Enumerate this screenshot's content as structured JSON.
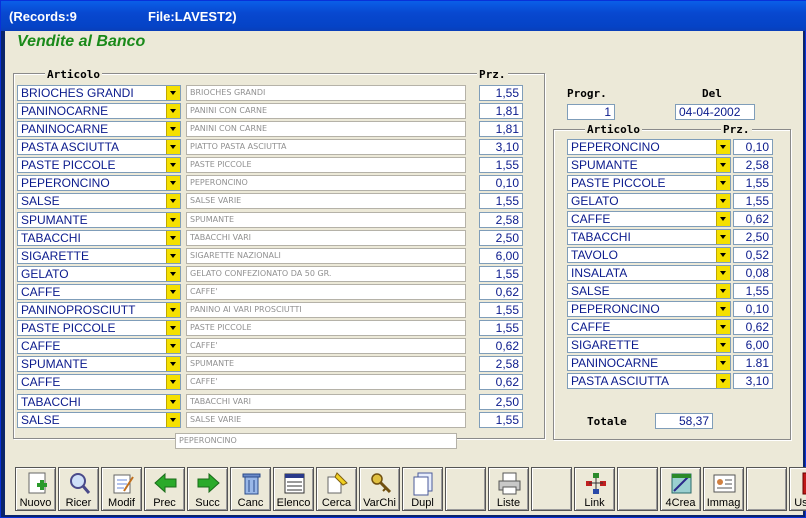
{
  "window": {
    "records": "(Records:9",
    "file": "File:LAVEST2)"
  },
  "app_title": "Vendite al Banco",
  "left": {
    "group_label": "Articolo",
    "price_label": "Prz.",
    "rows": [
      {
        "item": "BRIOCHES GRANDI",
        "desc": "BRIOCHES GRANDI",
        "price": "1,55"
      },
      {
        "item": "PANINOCARNE",
        "desc": "PANINI CON CARNE",
        "price": "1,81"
      },
      {
        "item": "PANINOCARNE",
        "desc": "PANINI CON CARNE",
        "price": "1,81"
      },
      {
        "item": "PASTA ASCIUTTA",
        "desc": "PIATTO PASTA ASCIUTTA",
        "price": "3,10"
      },
      {
        "item": "PASTE PICCOLE",
        "desc": "PASTE PICCOLE",
        "price": "1,55"
      },
      {
        "item": "PEPERONCINO",
        "desc": "PEPERONCINO",
        "price": "0,10"
      },
      {
        "item": "SALSE",
        "desc": "SALSE VARIE",
        "price": "1,55"
      },
      {
        "item": "SPUMANTE",
        "desc": "SPUMANTE",
        "price": "2,58"
      },
      {
        "item": "TABACCHI",
        "desc": "TABACCHI VARI",
        "price": "2,50"
      },
      {
        "item": "SIGARETTE",
        "desc": "SIGARETTE NAZIONALI",
        "price": "6,00"
      },
      {
        "item": "GELATO",
        "desc": "GELATO CONFEZIONATO DA 50 GR.",
        "price": "1,55"
      },
      {
        "item": "CAFFE",
        "desc": "CAFFE'",
        "price": "0,62"
      },
      {
        "item": "PANINOPROSCIUTT",
        "desc": "PANINO AI VARI PROSCIUTTI",
        "price": "1,55"
      },
      {
        "item": "PASTE PICCOLE",
        "desc": "PASTE PICCOLE",
        "price": "1,55"
      },
      {
        "item": "CAFFE",
        "desc": "CAFFE'",
        "price": "0,62"
      },
      {
        "item": "SPUMANTE",
        "desc": "SPUMANTE",
        "price": "2,58"
      },
      {
        "item": "CAFFE",
        "desc": "CAFFE'",
        "price": "0,62"
      },
      {
        "item": "TABACCHI",
        "desc": "TABACCHI VARI",
        "price": "2,50"
      },
      {
        "item": "SALSE",
        "desc": "SALSE VARIE",
        "price": "1,55"
      }
    ],
    "footer_desc": "PEPERONCINO"
  },
  "right": {
    "progr_label": "Progr.",
    "progr_value": "1",
    "del_label": "Del",
    "del_value": "04-04-2002",
    "group_label": "Articolo",
    "price_label": "Prz.",
    "rows": [
      {
        "item": "PEPERONCINO",
        "price": "0,10"
      },
      {
        "item": "SPUMANTE",
        "price": "2,58"
      },
      {
        "item": "PASTE PICCOLE",
        "price": "1,55"
      },
      {
        "item": "GELATO",
        "price": "1,55"
      },
      {
        "item": "CAFFE",
        "price": "0,62"
      },
      {
        "item": "TABACCHI",
        "price": "2,50"
      },
      {
        "item": "TAVOLO",
        "price": "0,52"
      },
      {
        "item": "INSALATA",
        "price": "0,08"
      },
      {
        "item": "SALSE",
        "price": "1,55"
      },
      {
        "item": "PEPERONCINO",
        "price": "0,10"
      },
      {
        "item": "CAFFE",
        "price": "0,62"
      },
      {
        "item": "SIGARETTE",
        "price": "6,00"
      },
      {
        "item": "PANINOCARNE",
        "price": "1.81"
      },
      {
        "item": "PASTA ASCIUTTA",
        "price": "3,10"
      }
    ],
    "total_label": "Totale",
    "total_value": "58,37"
  },
  "toolbar": [
    {
      "label": "Nuovo",
      "icon": "new-document-icon"
    },
    {
      "label": "Ricer",
      "icon": "search-icon"
    },
    {
      "label": "Modif",
      "icon": "edit-icon"
    },
    {
      "label": "Prec",
      "icon": "arrow-left-icon"
    },
    {
      "label": "Succ",
      "icon": "arrow-right-icon"
    },
    {
      "label": "Canc",
      "icon": "trash-icon"
    },
    {
      "label": "Elenco",
      "icon": "list-icon"
    },
    {
      "label": "Cerca",
      "icon": "find-icon"
    },
    {
      "label": "VarChi",
      "icon": "keys-icon"
    },
    {
      "label": "Dupl",
      "icon": "duplicate-icon"
    },
    {
      "label": "",
      "icon": ""
    },
    {
      "label": "Liste",
      "icon": "printer-icon"
    },
    {
      "label": "",
      "icon": ""
    },
    {
      "label": "Link",
      "icon": "link-tree-icon"
    },
    {
      "label": "",
      "icon": ""
    },
    {
      "label": "4Crea",
      "icon": "create-icon"
    },
    {
      "label": "Immag",
      "icon": "image-card-icon"
    },
    {
      "label": "",
      "icon": ""
    },
    {
      "label": "Uscita",
      "icon": "exit-door-icon"
    }
  ],
  "colors": {
    "accent_text": "#0a1a8c",
    "title_green": "#1a8a1a",
    "dropdown_yellow": "#f5e000"
  }
}
